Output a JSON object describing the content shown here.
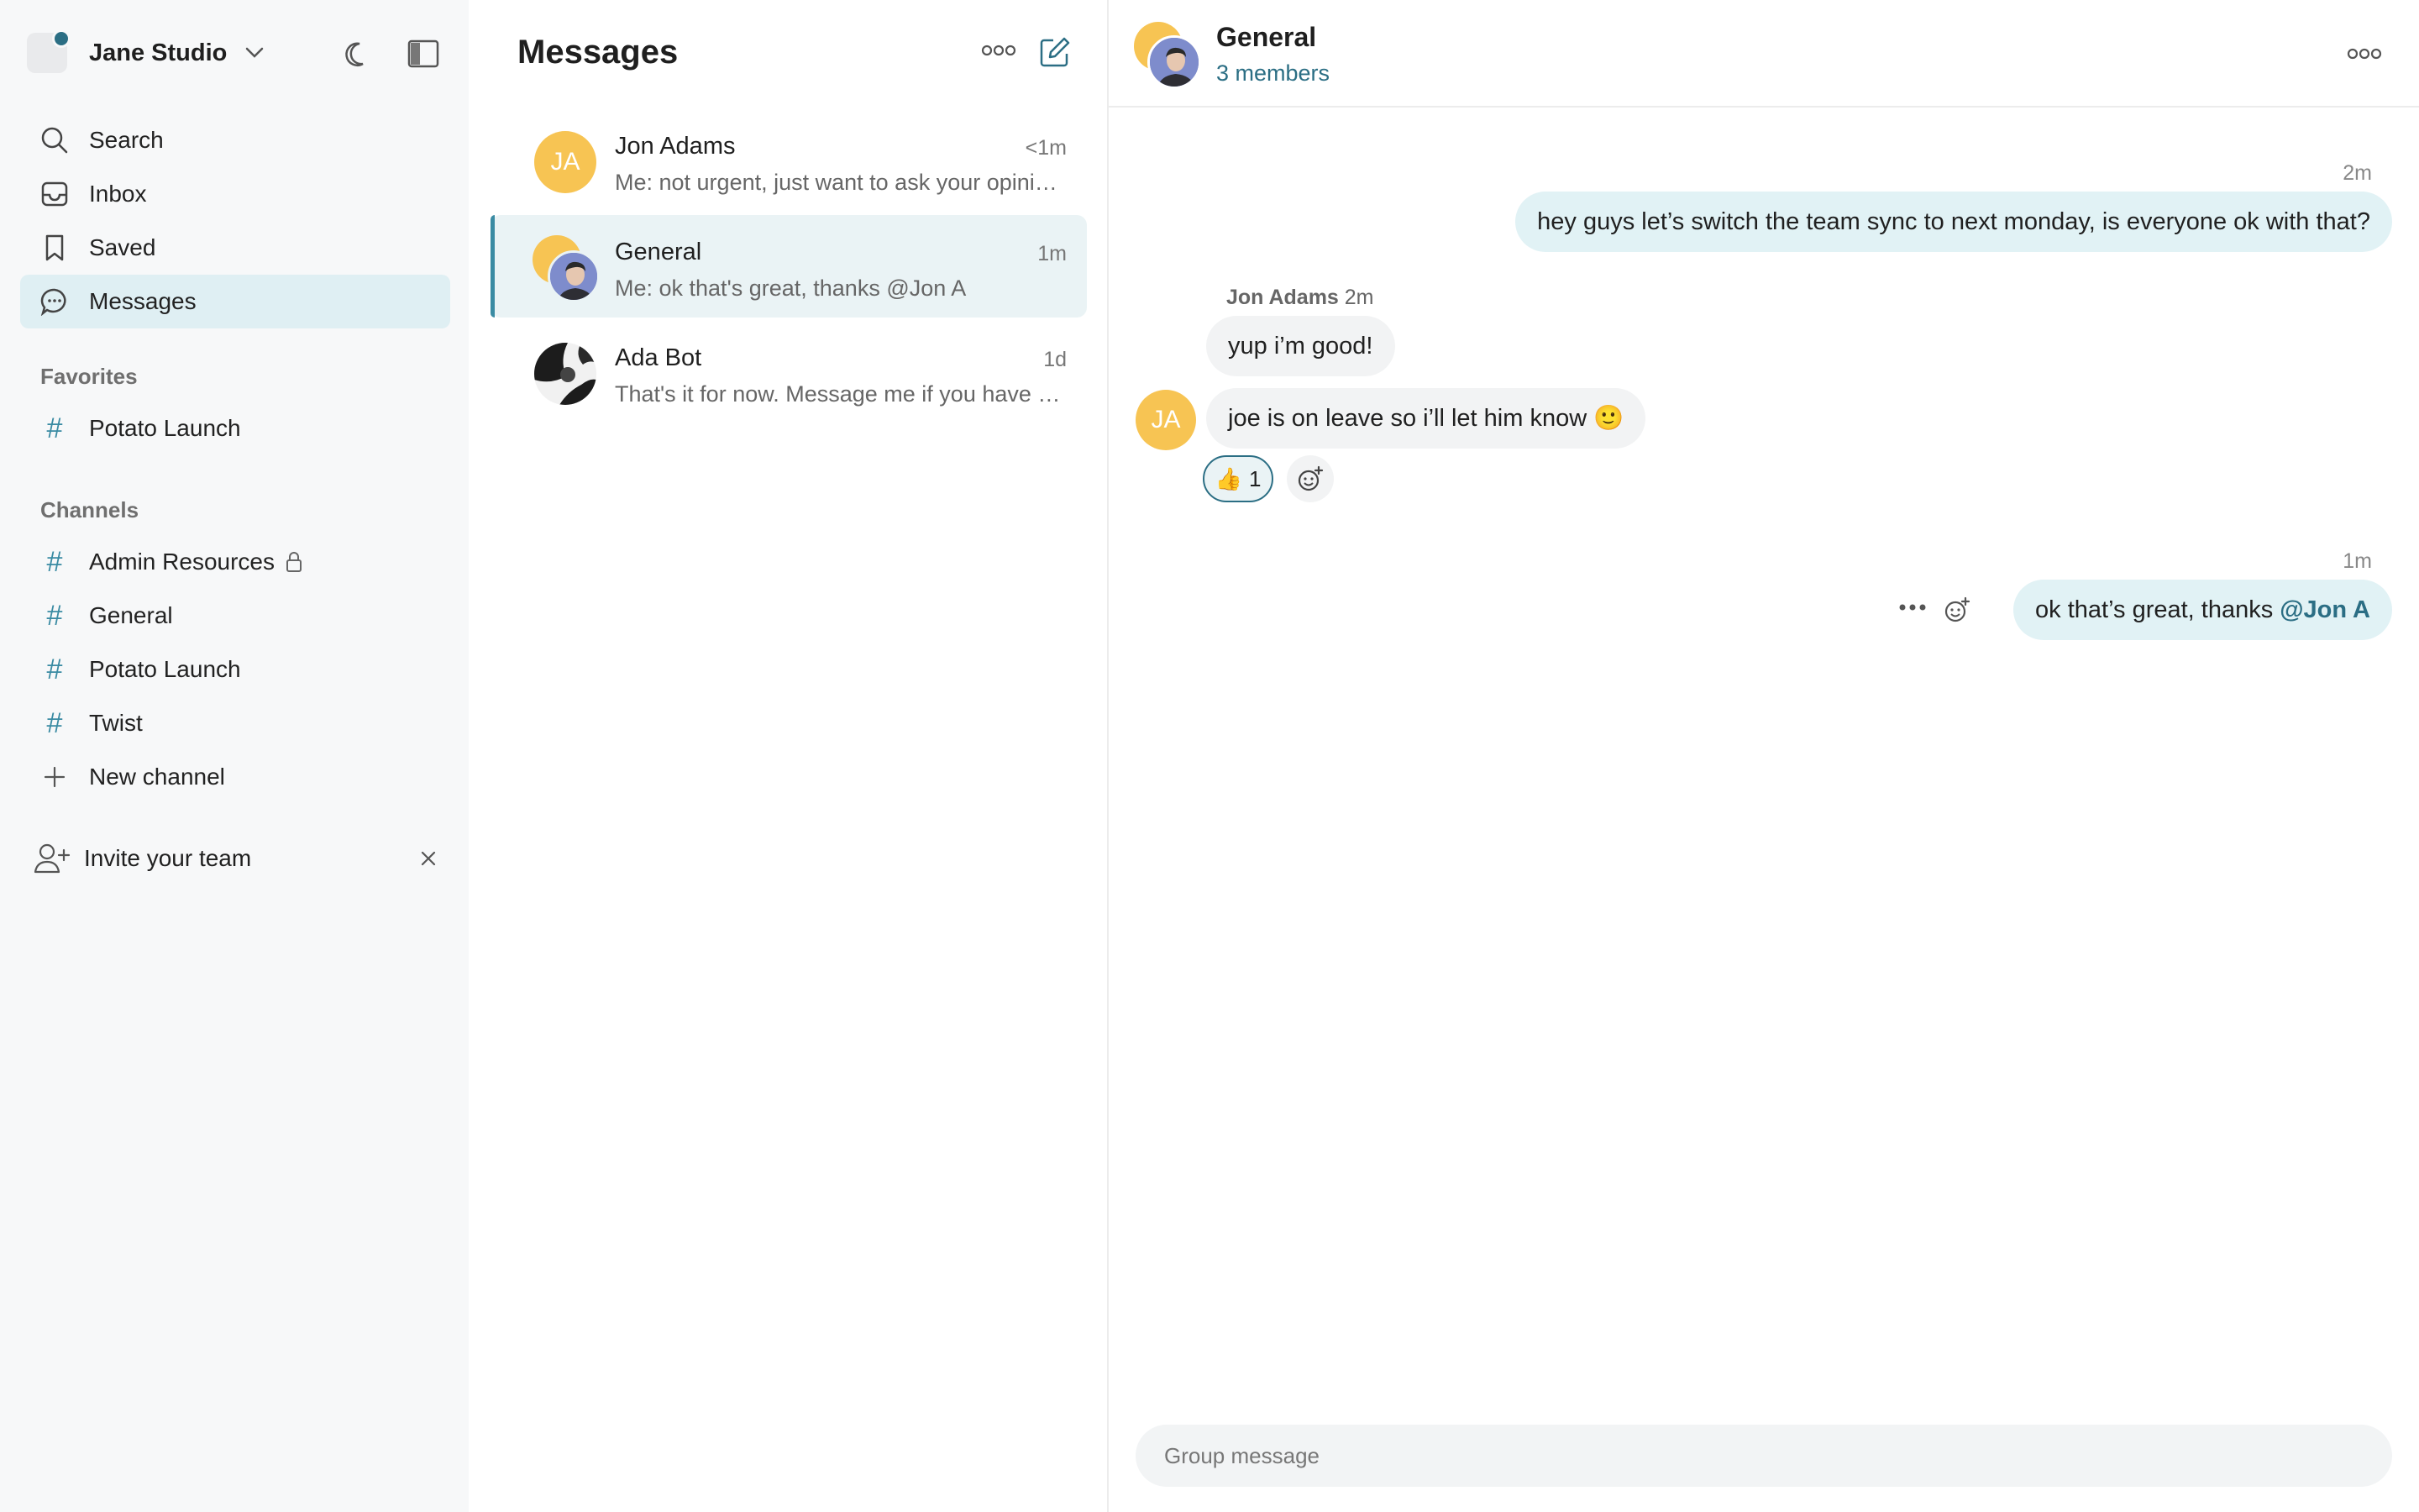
{
  "sidebar": {
    "workspace_name": "Jane Studio",
    "nav": [
      {
        "label": "Search",
        "icon": "search-icon"
      },
      {
        "label": "Inbox",
        "icon": "inbox-icon"
      },
      {
        "label": "Saved",
        "icon": "bookmark-icon"
      },
      {
        "label": "Messages",
        "icon": "chat-bubble-icon",
        "active": true
      }
    ],
    "favorites_label": "Favorites",
    "favorites": [
      {
        "label": "Potato Launch"
      }
    ],
    "channels_label": "Channels",
    "channels": [
      {
        "label": "Admin Resources",
        "locked": true
      },
      {
        "label": "General"
      },
      {
        "label": "Potato Launch"
      },
      {
        "label": "Twist"
      }
    ],
    "new_channel_label": "New channel",
    "invite_label": "Invite your team"
  },
  "conversations": {
    "title": "Messages",
    "items": [
      {
        "name": "Jon Adams",
        "initials": "JA",
        "time": "<1m",
        "preview": "Me: not urgent, just want to ask your opinion on something"
      },
      {
        "name": "General",
        "time": "1m",
        "preview": "Me: ok that's great, thanks @Jon A",
        "active": true
      },
      {
        "name": "Ada Bot",
        "time": "1d",
        "preview": "That's it for now. Message me if you have any questions"
      }
    ]
  },
  "chat": {
    "title": "General",
    "members": "3 members",
    "messages": [
      {
        "time": "2m",
        "text": "hey guys let’s switch the team sync to next monday, is everyone ok with that?"
      },
      {
        "sender": "Jon Adams",
        "time": "2m",
        "text": "yup i’m good!"
      },
      {
        "initials": "JA",
        "text": "joe is on leave so i’ll let him know 🙂"
      },
      {
        "reaction_emoji": "👍",
        "reaction_count": "1"
      },
      {
        "time": "1m",
        "text": "ok that’s great, thanks",
        "mention": "@Jon A"
      }
    ],
    "composer_placeholder": "Group message"
  },
  "colors": {
    "accent": "#2b6e84",
    "avatar_yellow": "#f7c453",
    "active_bg": "#dfeff3"
  }
}
